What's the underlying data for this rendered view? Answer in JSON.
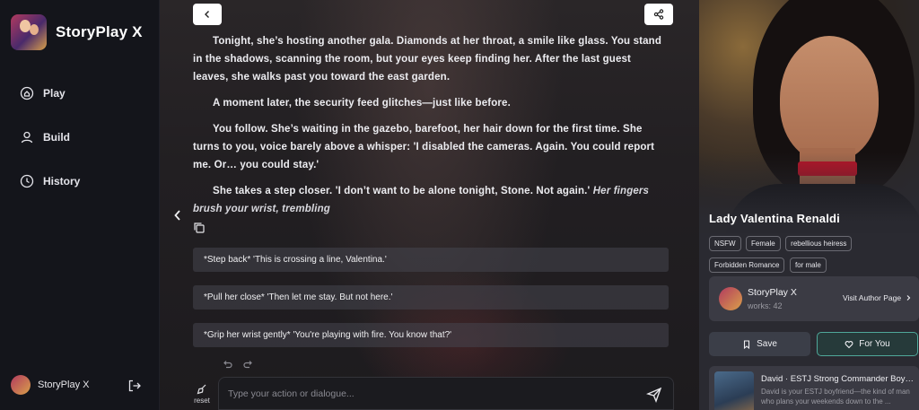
{
  "app": {
    "name": "StoryPlay X"
  },
  "sidebar": {
    "items": [
      {
        "label": "Play",
        "icon": "home-icon"
      },
      {
        "label": "Build",
        "icon": "user-icon"
      },
      {
        "label": "History",
        "icon": "clock-icon"
      }
    ],
    "user": {
      "name": "StoryPlay X"
    }
  },
  "story": {
    "p1": "Tonight, she’s hosting another gala. Diamonds at her throat, a smile like glass. You stand in the shadows, scanning the room, but your eyes keep finding her. After the last guest leaves, she walks past you toward the east garden.",
    "p2": "A moment later, the security feed glitches—just like before.",
    "p3": "You follow. She’s waiting in the gazebo, barefoot, her hair down for the first time. She turns to you, voice barely above a whisper: 'I disabled the cameras. Again. You could report me. Or… you could stay.'",
    "p4_text": "She takes a step closer. 'I don’t want to be alone tonight, Stone. Not again.' ",
    "p4_italic": "Her fingers brush your wrist, trembling"
  },
  "choices": [
    "*Step back* 'This is crossing a line, Valentina.'",
    "*Pull her close* 'Then let me stay. But not here.'",
    "*Grip her wrist gently* 'You're playing with fire. You know that?'"
  ],
  "composer": {
    "placeholder": "Type your action or dialogue...",
    "reset_label": "reset"
  },
  "character": {
    "name": "Lady Valentina Renaldi",
    "tags": [
      "NSFW",
      "Female",
      "rebellious heiress",
      "Forbidden Romance",
      "for male"
    ]
  },
  "author": {
    "name": "StoryPlay X",
    "works": "works: 42",
    "visit_label": "Visit Author Page"
  },
  "actions": {
    "save_label": "Save",
    "foryou_label": "For You"
  },
  "recommendation": {
    "title": "David · ESTJ Strong Commander Boyf…",
    "desc": "David is your ESTJ boyfriend—the kind of man who plans your weekends down to the ..."
  },
  "colors": {
    "accent": "#4fa89a",
    "choker": "#b81428",
    "panel": "#2a2a31"
  }
}
